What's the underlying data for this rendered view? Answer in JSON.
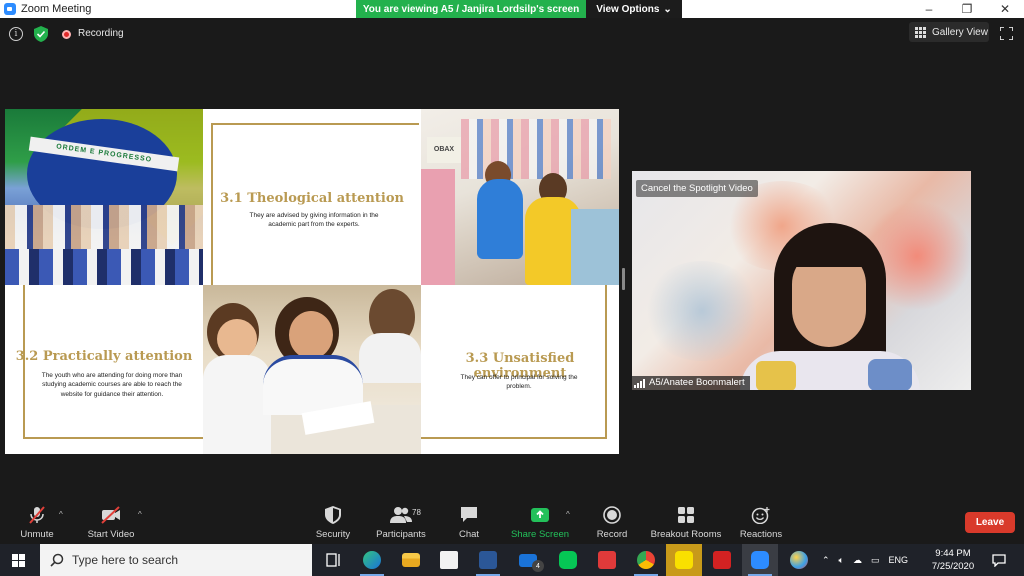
{
  "window": {
    "title": "Zoom Meeting",
    "controls": {
      "minimize": "–",
      "restore": "❐",
      "close": "✕"
    }
  },
  "share_banner": {
    "viewing": "You are viewing A5 / Janjira Lordsilp's screen",
    "options": "View Options",
    "options_caret": "⌄"
  },
  "topbar": {
    "recording": "Recording",
    "gallery_view": "Gallery View"
  },
  "slide": {
    "section1": {
      "heading": "3.1 Theological attention",
      "body": "They are advised by giving information in the academic part from the experts."
    },
    "section2": {
      "heading": "3.2 Practically attention",
      "body": "The youth who are attending for doing more than studying academic courses are able to reach the website for guidance their attention."
    },
    "section3": {
      "heading": "3.3 Unsatisfied environment",
      "body": "They can offer to principal for solving the problem."
    },
    "photo1_band": "ORDEM E PROGRESSO",
    "photo2_sign": "OBAX"
  },
  "video": {
    "spotlight_label": "Cancel the Spotlight Video",
    "participant_name": "A5/Anatee Boonmalert"
  },
  "toolbar": {
    "unmute": "Unmute",
    "start_video": "Start Video",
    "security": "Security",
    "participants": "Participants",
    "participants_count": "78",
    "chat": "Chat",
    "share_screen": "Share Screen",
    "record": "Record",
    "breakout_rooms": "Breakout Rooms",
    "reactions": "Reactions",
    "leave": "Leave",
    "caret": "^"
  },
  "taskbar": {
    "search_placeholder": "Type here to search",
    "mail_badge": "4",
    "language": "ENG",
    "time": "9:44 PM",
    "date": "7/25/2020"
  },
  "colors": {
    "zoom_blue": "#2d8cff",
    "banner_green": "#23b14d",
    "share_green": "#23c05a",
    "slide_gold": "#b99a52",
    "leave_red": "#d93a2b",
    "taskbar": "#1f2229"
  }
}
